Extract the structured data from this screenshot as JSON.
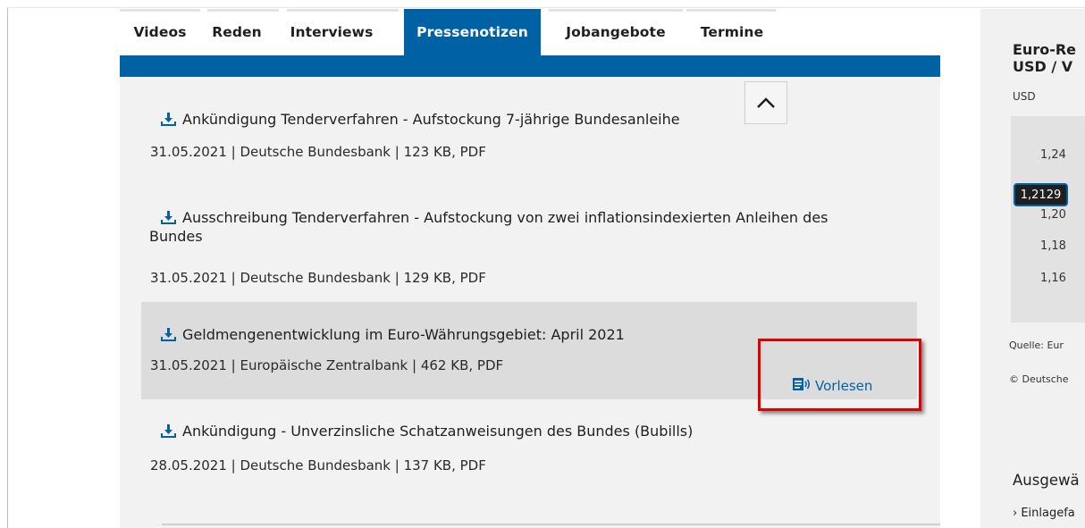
{
  "tabs": [
    {
      "label": "Videos",
      "active": false
    },
    {
      "label": "Reden",
      "active": false
    },
    {
      "label": "Interviews",
      "active": false
    },
    {
      "label": "Pressenotizen",
      "active": true
    },
    {
      "label": "Jobangebote",
      "active": false
    },
    {
      "label": "Termine",
      "active": false
    }
  ],
  "colors": {
    "accent": "#0062a4",
    "highlight_box": "#e00000",
    "content_bg": "#f2f2f2"
  },
  "collapse_button": {
    "icon": "chevron-up-icon"
  },
  "press_items": [
    {
      "title": "Ankündigung Tenderverfahren - Aufstockung 7-jährige Bundesanleihe",
      "meta": "31.05.2021 | Deutsche Bundesbank | 123 KB, PDF",
      "icon": "download-icon"
    },
    {
      "title_line1": "Ausschreibung Tenderverfahren - Aufstockung von zwei inflationsindexierten Anleihen des",
      "title_line2": "Bundes",
      "meta": "31.05.2021 | Deutsche Bundesbank | 129 KB, PDF",
      "icon": "download-icon"
    },
    {
      "title": "Geldmengenentwicklung im Euro-Währungsgebiet: April 2021",
      "meta": "31.05.2021 | Europäische Zentralbank | 462 KB, PDF",
      "icon": "download-icon",
      "highlighted": true
    },
    {
      "title": "Ankündigung - Unverzinsliche Schatzanweisungen des Bundes (Bubills)",
      "meta": "28.05.2021 | Deutsche Bundesbank | 137 KB, PDF",
      "icon": "download-icon"
    }
  ],
  "read_aloud": {
    "label": "Vorlesen",
    "icon": "read-aloud-icon"
  },
  "sidebar": {
    "title_line1": "Euro-Re",
    "title_line2": "USD / V",
    "unit": "USD",
    "ticks": [
      "1,24",
      "1,20",
      "1,18",
      "1,16"
    ],
    "tooltip_value": "1,2129",
    "source": "Quelle: Eur",
    "copyright": "© Deutsche",
    "section_heading": "Ausgewä",
    "links": [
      "› Einlagefa"
    ]
  }
}
